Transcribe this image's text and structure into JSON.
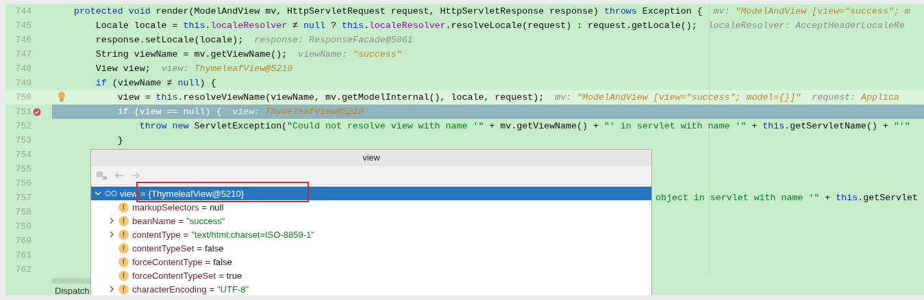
{
  "editor": {
    "lines": [
      {
        "number": "744",
        "caret_line": false,
        "execution_line": false,
        "breakpoint": false,
        "intention": false,
        "segments": [
          {
            "kind": "kw",
            "text": "protected void "
          },
          {
            "kind": "plain",
            "text": "render(ModelAndView mv, HttpServletRequest request, HttpServletResponse response) "
          },
          {
            "kind": "kw",
            "text": "throws "
          },
          {
            "kind": "plain",
            "text": "Exception {"
          },
          {
            "kind": "hint",
            "text": "mv: "
          },
          {
            "kind": "hint_value",
            "text": "\"ModelAndView [view=\"success\"; m"
          }
        ],
        "children": [
          {
            "number": "745",
            "caret_line": false,
            "execution_line": false,
            "breakpoint": false,
            "intention": false,
            "segments": [
              {
                "kind": "plain",
                "text": "Locale locale = "
              },
              {
                "kind": "kw",
                "text": "this"
              },
              {
                "kind": "plain",
                "text": "."
              },
              {
                "kind": "field",
                "text": "localeResolver"
              },
              {
                "kind": "plain",
                "text": " ≠ "
              },
              {
                "kind": "kw",
                "text": "null"
              },
              {
                "kind": "plain",
                "text": " ? "
              },
              {
                "kind": "kw",
                "text": "this"
              },
              {
                "kind": "plain",
                "text": "."
              },
              {
                "kind": "field",
                "text": "localeResolver"
              },
              {
                "kind": "plain",
                "text": ".resolveLocale(request) : request.getLocale();"
              },
              {
                "kind": "hint",
                "text": "localeResolver: AcceptHeaderLocaleRe"
              }
            ]
          },
          {
            "number": "746",
            "caret_line": false,
            "execution_line": false,
            "breakpoint": false,
            "intention": false,
            "segments": [
              {
                "kind": "plain",
                "text": "response.setLocale(locale);"
              },
              {
                "kind": "hint",
                "text": "response: ResponseFacade@5061"
              }
            ]
          },
          {
            "number": "747",
            "caret_line": false,
            "execution_line": false,
            "breakpoint": false,
            "intention": false,
            "segments": [
              {
                "kind": "plain",
                "text": "String viewName = mv.getViewName();"
              },
              {
                "kind": "hint",
                "text": "viewName: "
              },
              {
                "kind": "hint_value",
                "text": "\"success\""
              }
            ]
          },
          {
            "number": "748",
            "caret_line": false,
            "execution_line": false,
            "breakpoint": false,
            "intention": false,
            "segments": [
              {
                "kind": "plain",
                "text": "View view;"
              },
              {
                "kind": "hint",
                "text": "view: "
              },
              {
                "kind": "hint_value",
                "text": "ThymeleafView@5210"
              }
            ]
          },
          {
            "number": "749",
            "caret_line": false,
            "execution_line": false,
            "breakpoint": false,
            "intention": false,
            "segments": [
              {
                "kind": "kw",
                "text": "if"
              },
              {
                "kind": "plain",
                "text": " (viewName ≠ "
              },
              {
                "kind": "kw",
                "text": "null"
              },
              {
                "kind": "plain",
                "text": ") {"
              }
            ],
            "children": [
              {
                "number": "750",
                "caret_line": true,
                "execution_line": false,
                "breakpoint": false,
                "intention": true,
                "segments": [
                  {
                    "kind": "plain",
                    "text": "view = "
                  },
                  {
                    "kind": "kw",
                    "text": "this"
                  },
                  {
                    "kind": "plain",
                    "text": ".resolveViewName(viewName, mv.getModelInternal(), locale, request);"
                  },
                  {
                    "kind": "hint",
                    "text": "mv: "
                  },
                  {
                    "kind": "hint_value",
                    "text": "\"ModelAndView [view=\"success\"; model={}]\""
                  },
                  {
                    "kind": "hint",
                    "text": "request: "
                  },
                  {
                    "kind": "hint_value",
                    "text": "Applica"
                  }
                ]
              },
              {
                "number": "751",
                "caret_line": false,
                "execution_line": true,
                "breakpoint": true,
                "intention": false,
                "segments": [
                  {
                    "kind": "plain",
                    "text": "if (view == null) {"
                  },
                  {
                    "kind": "hint_faint",
                    "text": "view: "
                  },
                  {
                    "kind": "hint_value",
                    "text": "ThymeleafView@5210"
                  }
                ],
                "children": [
                  {
                    "number": "752",
                    "caret_line": false,
                    "execution_line": false,
                    "breakpoint": false,
                    "intention": false,
                    "segments": [
                      {
                        "kind": "kw",
                        "text": "throw new "
                      },
                      {
                        "kind": "plain",
                        "text": "ServletException("
                      },
                      {
                        "kind": "str",
                        "text": "\"Could not resolve view with name '\""
                      },
                      {
                        "kind": "plain",
                        "text": " + mv.getViewName() + "
                      },
                      {
                        "kind": "str",
                        "text": "\"' in servlet with name '\""
                      },
                      {
                        "kind": "plain",
                        "text": " + "
                      },
                      {
                        "kind": "kw",
                        "text": "this"
                      },
                      {
                        "kind": "plain",
                        "text": ".getServletName() + "
                      },
                      {
                        "kind": "str",
                        "text": "\"'\""
                      }
                    ]
                  }
                ]
              },
              {
                "number": "753",
                "caret_line": false,
                "execution_line": false,
                "breakpoint": false,
                "intention": false,
                "segments": [
                  {
                    "kind": "plain",
                    "text": "}"
                  }
                ]
              }
            ]
          }
        ]
      },
      {
        "number": "754",
        "caret_line": false,
        "execution_line": false,
        "breakpoint": false,
        "intention": false
      },
      {
        "number": "755",
        "caret_line": false,
        "execution_line": false,
        "breakpoint": false,
        "intention": false
      },
      {
        "number": "756",
        "caret_line": false,
        "execution_line": false,
        "breakpoint": false,
        "intention": false
      },
      {
        "number": "757",
        "caret_line": false,
        "execution_line": false,
        "breakpoint": false,
        "intention": false,
        "tail_segments": [
          {
            "kind": "str",
            "text": "object in servlet with name '\""
          },
          {
            "kind": "plain",
            "text": " + "
          },
          {
            "kind": "kw",
            "text": "this"
          },
          {
            "kind": "plain",
            "text": ".getServlet"
          }
        ]
      },
      {
        "number": "758",
        "caret_line": false,
        "execution_line": false,
        "breakpoint": false,
        "intention": false
      },
      {
        "number": "759",
        "caret_line": false,
        "execution_line": false,
        "breakpoint": false,
        "intention": false
      },
      {
        "number": "760",
        "caret_line": false,
        "execution_line": false,
        "breakpoint": false,
        "intention": false
      },
      {
        "number": "761",
        "caret_line": false,
        "execution_line": false,
        "breakpoint": false,
        "intention": false
      },
      {
        "number": "762",
        "caret_line": false,
        "execution_line": false,
        "breakpoint": false,
        "intention": false
      }
    ],
    "bottom_tab": "Dispatch"
  },
  "popup": {
    "title": "view",
    "tree": [
      {
        "name": "view",
        "operator": "=",
        "value": "{ThymeleafView@5210}",
        "kind": "watch",
        "expandable": true,
        "expanded": true,
        "selected": true,
        "children": [
          {
            "name": "markupSelectors",
            "operator": "=",
            "value": "null",
            "string_value": false,
            "kind": "field",
            "icon": "f",
            "expandable": false,
            "expanded": false,
            "selected": false
          },
          {
            "name": "beanName",
            "operator": "=",
            "value": "\"success\"",
            "string_value": true,
            "kind": "field",
            "icon": "f",
            "expandable": true,
            "expanded": false,
            "selected": false
          },
          {
            "name": "contentType",
            "operator": "=",
            "value": "\"text/html;charset=ISO-8859-1\"",
            "string_value": true,
            "kind": "field",
            "icon": "f",
            "expandable": true,
            "expanded": false,
            "selected": false
          },
          {
            "name": "contentTypeSet",
            "operator": "=",
            "value": "false",
            "string_value": false,
            "kind": "field",
            "icon": "f",
            "expandable": false,
            "expanded": false,
            "selected": false
          },
          {
            "name": "forceContentType",
            "operator": "=",
            "value": "false",
            "string_value": false,
            "kind": "field",
            "icon": "f",
            "expandable": false,
            "expanded": false,
            "selected": false
          },
          {
            "name": "forceContentTypeSet",
            "operator": "=",
            "value": "true",
            "string_value": false,
            "kind": "field",
            "icon": "f",
            "expandable": false,
            "expanded": false,
            "selected": false
          },
          {
            "name": "characterEncoding",
            "operator": "=",
            "value": "\"UTF-8\"",
            "string_value": true,
            "kind": "field",
            "icon": "f",
            "expandable": true,
            "expanded": false,
            "selected": false
          }
        ]
      }
    ]
  }
}
